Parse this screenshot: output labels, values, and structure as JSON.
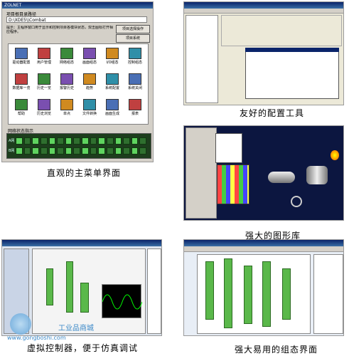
{
  "captions": {
    "main_menu": "直观的主菜单界面",
    "config_tool": "友好的配置工具",
    "graphics_lib": "强大的图形库",
    "controller": "虚拟控制器，便于仿真调试",
    "scada": "强大易用的组态界面"
  },
  "main_window": {
    "title": "ZOLNET",
    "project_label": "项目根目录路径",
    "project_path": "D:\\XDE5\\\\Combat",
    "hint_text": "提示：主程序窗口用于显示和控制项目各模块状态，双击图标打开相应程序。",
    "button_primary": "项目选择操作",
    "button_secondary": "项目系统",
    "icons": [
      "驱动器配置",
      "用户管理",
      "网络组态",
      "画面组态",
      "I/O组态",
      "控制组态",
      "数据库一览",
      "历史一览",
      "报警历史",
      "趋势",
      "系统配置",
      "系统关闭",
      "帮助",
      "历史浏览",
      "单点",
      "文件转换",
      "画面生成",
      "报表"
    ],
    "status_label": "网络状态指示",
    "row_a": "A网",
    "row_b": "B网"
  },
  "watermark": {
    "site": "www.gongboshi.com",
    "name": "工业品商城"
  }
}
